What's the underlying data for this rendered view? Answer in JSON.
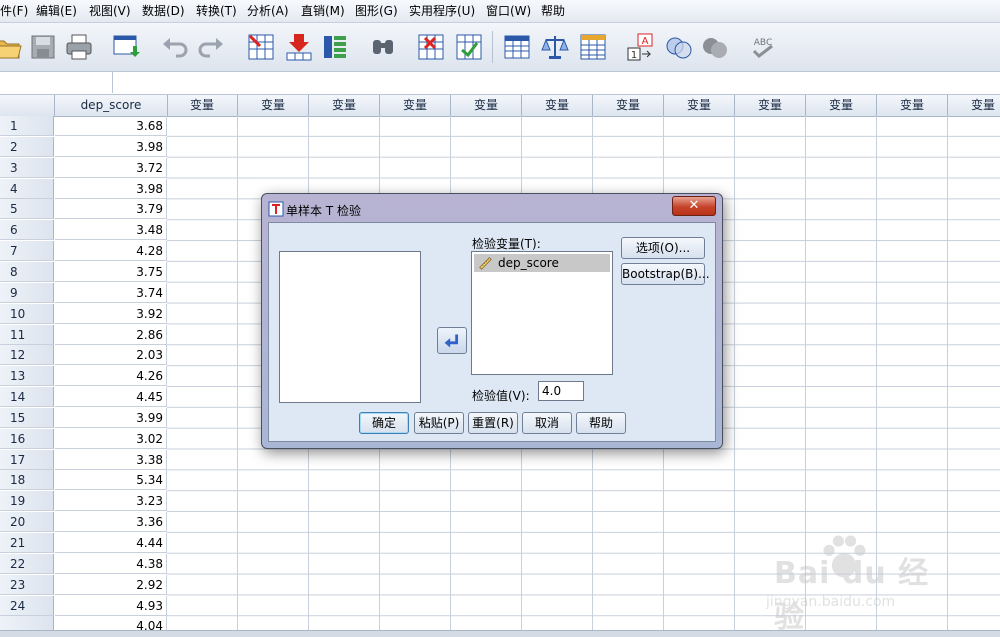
{
  "menu": [
    {
      "label": "件(F)"
    },
    {
      "label": "编辑(E)"
    },
    {
      "label": "视图(V)"
    },
    {
      "label": "数据(D)"
    },
    {
      "label": "转换(T)"
    },
    {
      "label": "分析(A)"
    },
    {
      "label": "直销(M)"
    },
    {
      "label": "图形(G)"
    },
    {
      "label": "实用程序(U)"
    },
    {
      "label": "窗口(W)"
    },
    {
      "label": "帮助"
    }
  ],
  "toolbar": {
    "icons": [
      "open-folder-icon",
      "save-icon",
      "print-icon",
      "dialog-recall-icon",
      "undo-icon",
      "redo-icon",
      "goto-case-icon",
      "goto-variable-icon",
      "variables-icon",
      "find-icon",
      "insert-cases-icon",
      "insert-variable-icon",
      "split-file-icon",
      "weight-cases-icon",
      "select-cases-icon",
      "value-labels-icon",
      "use-sets-icon",
      "show-all-variables-icon",
      "spell-check-icon"
    ],
    "spellcheck_text": "ABC"
  },
  "grid": {
    "first_column": "dep_score",
    "empty_column": "变量",
    "empty_column_count": 12,
    "rows": [
      {
        "n": "1",
        "v": "3.68"
      },
      {
        "n": "2",
        "v": "3.98"
      },
      {
        "n": "3",
        "v": "3.72"
      },
      {
        "n": "4",
        "v": "3.98"
      },
      {
        "n": "5",
        "v": "3.79"
      },
      {
        "n": "6",
        "v": "3.48"
      },
      {
        "n": "7",
        "v": "4.28"
      },
      {
        "n": "8",
        "v": "3.75"
      },
      {
        "n": "9",
        "v": "3.74"
      },
      {
        "n": "10",
        "v": "3.92"
      },
      {
        "n": "11",
        "v": "2.86"
      },
      {
        "n": "12",
        "v": "2.03"
      },
      {
        "n": "13",
        "v": "4.26"
      },
      {
        "n": "14",
        "v": "4.45"
      },
      {
        "n": "15",
        "v": "3.99"
      },
      {
        "n": "16",
        "v": "3.02"
      },
      {
        "n": "17",
        "v": "3.38"
      },
      {
        "n": "18",
        "v": "5.34"
      },
      {
        "n": "19",
        "v": "3.23"
      },
      {
        "n": "20",
        "v": "3.36"
      },
      {
        "n": "21",
        "v": "4.44"
      },
      {
        "n": "22",
        "v": "4.38"
      },
      {
        "n": "23",
        "v": "2.92"
      },
      {
        "n": "24",
        "v": "4.93"
      },
      {
        "n": "",
        "v": "4.04"
      }
    ]
  },
  "dialog": {
    "title": "单样本 T 检验",
    "close_glyph": "✕",
    "test_variables_label": "检验变量(T):",
    "test_variables": [
      "dep_score"
    ],
    "test_value_label": "检验值(V):",
    "test_value": "4.0",
    "buttons": {
      "options": "选项(O)...",
      "bootstrap": "Bootstrap(B)...",
      "ok": "确定",
      "paste": "粘贴(P)",
      "reset": "重置(R)",
      "cancel": "取消",
      "help": "帮助"
    }
  },
  "watermark": {
    "brand": "Bai du 经验",
    "url": "jingyan.baidu.com"
  }
}
